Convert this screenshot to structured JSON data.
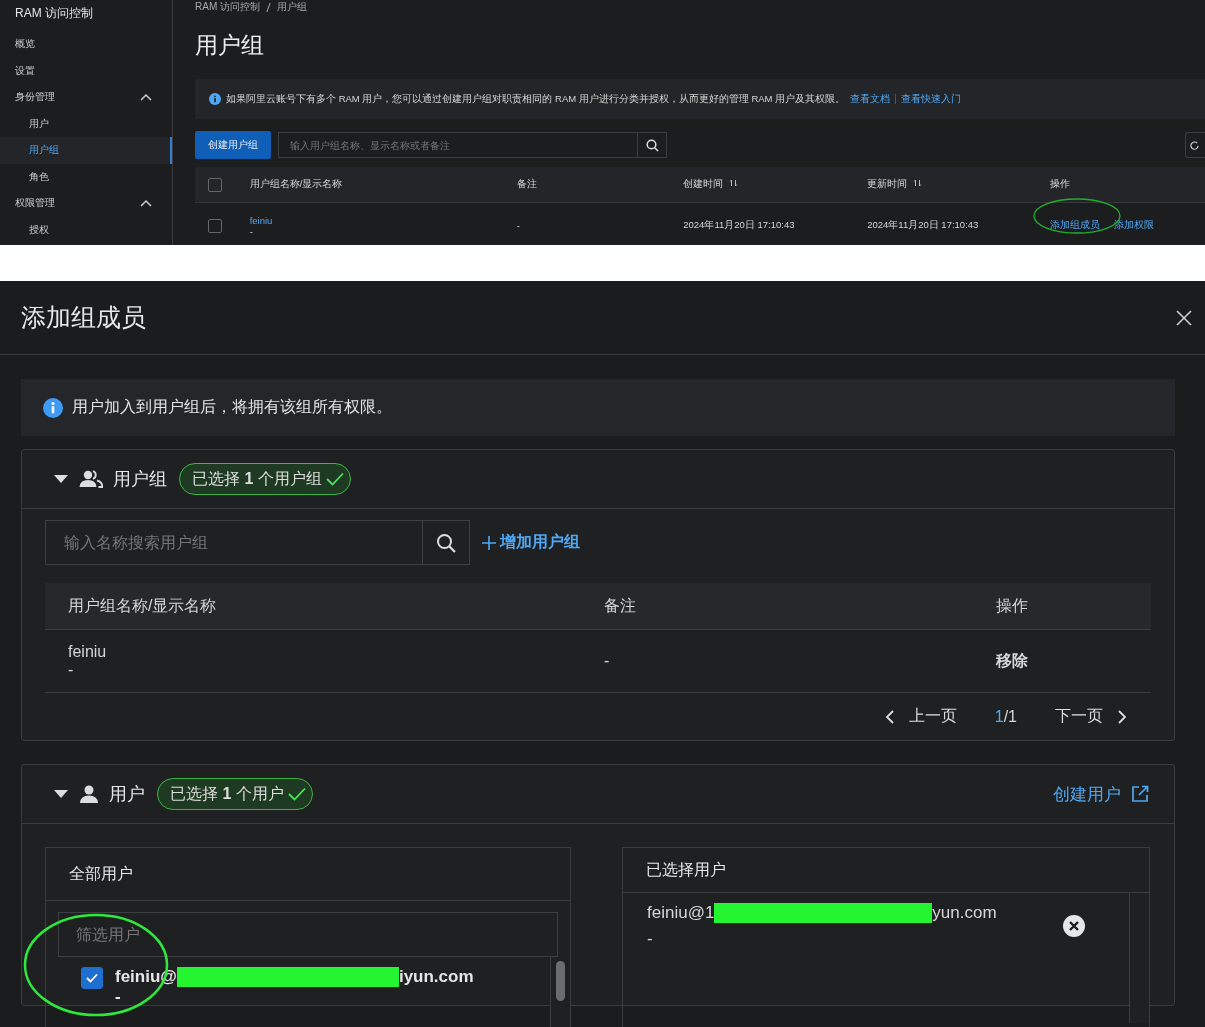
{
  "console": {
    "sidebar": {
      "title": "RAM 访问控制",
      "items": [
        {
          "label": "概览",
          "selected": false
        },
        {
          "label": "设置",
          "selected": false
        },
        {
          "label": "身份管理",
          "selected": false,
          "expanded": true,
          "children": [
            {
              "label": "用户",
              "selected": false
            },
            {
              "label": "用户组",
              "selected": true
            },
            {
              "label": "角色",
              "selected": false
            }
          ]
        },
        {
          "label": "权限管理",
          "selected": false,
          "expanded": true,
          "children": [
            {
              "label": "授权",
              "selected": false
            }
          ]
        }
      ]
    },
    "breadcrumb": [
      "RAM 访问控制",
      "用户组"
    ],
    "page_title": "用户组",
    "notice": {
      "text": "如果阿里云账号下有多个 RAM 用户，您可以通过创建用户组对职责相同的 RAM 用户进行分类并授权，从而更好的管理 RAM 用户及其权限。",
      "links": [
        "查看文档",
        "查看快速入门"
      ]
    },
    "toolbar": {
      "create_button": "创建用户组",
      "search_placeholder": "输入用户组名称、显示名称或者备注"
    },
    "table": {
      "select_all_checked": false,
      "columns": [
        {
          "label": "用户组名称/显示名称",
          "sortable": false
        },
        {
          "label": "备注",
          "sortable": false
        },
        {
          "label": "创建时间",
          "sortable": true
        },
        {
          "label": "更新时间",
          "sortable": true
        },
        {
          "label": "操作",
          "sortable": false
        }
      ],
      "rows": [
        {
          "checked": false,
          "name": "feiniu",
          "display_name": "-",
          "remark": "-",
          "created": "2024年11月20日 17:10:43",
          "updated": "2024年11月20日 17:10:43",
          "actions": [
            "添加组成员",
            "添加权限"
          ]
        }
      ]
    }
  },
  "modal": {
    "title": "添加组成员",
    "info": "用户加入到用户组后，将拥有该组所有权限。",
    "group_section": {
      "title": "用户组",
      "expanded": true,
      "badge": "已选择 **1** 个用户组",
      "search_placeholder": "输入名称搜索用户组",
      "add_link": "增加用户组",
      "columns": [
        "用户组名称/显示名称",
        "备注",
        "操作"
      ],
      "rows": [
        {
          "name": "feiniu",
          "display_name": "-",
          "remark": "-",
          "action": "移除"
        }
      ],
      "pagination": {
        "prev": "上一页",
        "current": "1",
        "total": "/1",
        "next": "下一页"
      }
    },
    "user_section": {
      "title": "用户",
      "expanded": true,
      "badge": "已选择 **1** 个用户",
      "create_link": "创建用户",
      "all_users": {
        "title": "全部用户",
        "filter_placeholder": "筛选用户",
        "items": [
          {
            "checked": true,
            "name_start": "feiniu@",
            "name_end": "iyun.com",
            "display_name": "-"
          }
        ]
      },
      "selected_users": {
        "title": "已选择用户",
        "items": [
          {
            "name_start": "feiniu@1",
            "name_end": "yun.com",
            "display_name": "-"
          }
        ]
      }
    }
  }
}
